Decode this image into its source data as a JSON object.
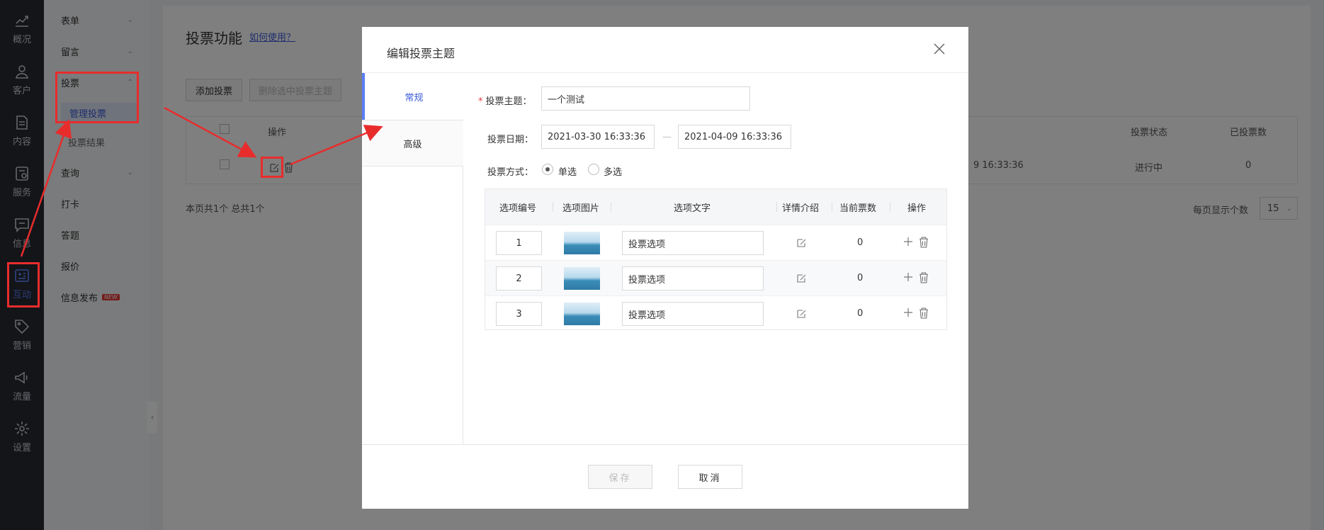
{
  "rail": {
    "items": [
      {
        "label": "概况",
        "icon": "chart-icon"
      },
      {
        "label": "客户",
        "icon": "user-icon"
      },
      {
        "label": "内容",
        "icon": "document-icon"
      },
      {
        "label": "服务",
        "icon": "service-icon"
      },
      {
        "label": "信息",
        "icon": "message-icon"
      },
      {
        "label": "互动",
        "icon": "interact-icon",
        "active": true
      },
      {
        "label": "营销",
        "icon": "tag-icon"
      },
      {
        "label": "流量",
        "icon": "megaphone-icon"
      },
      {
        "label": "设置",
        "icon": "settings-icon"
      }
    ]
  },
  "sidebar": {
    "items": [
      {
        "label": "表单"
      },
      {
        "label": "留言"
      },
      {
        "label": "投票"
      },
      {
        "label": "管理投票"
      },
      {
        "label": "投票结果"
      },
      {
        "label": "查询"
      },
      {
        "label": "打卡"
      },
      {
        "label": "答题"
      },
      {
        "label": "报价"
      },
      {
        "label": "信息发布",
        "badge": "NEW"
      }
    ]
  },
  "main": {
    "title": "投票功能",
    "help_link": "如何使用？",
    "add_button": "添加投票",
    "delete_button": "删除选中投票主题",
    "columns": {
      "action": "操作",
      "status": "投票状态",
      "votes": "已投票数"
    },
    "row": {
      "end_time": "9 16:33:36",
      "status": "进行中",
      "votes": "0"
    },
    "footer": "本页共1个  总共1个",
    "page_size_label": "每页显示个数",
    "page_size": "15"
  },
  "modal": {
    "title": "编辑投票主题",
    "tabs": [
      "常规",
      "高级"
    ],
    "topic_label": "投票主题：",
    "topic_value": "一个测试",
    "date_label": "投票日期：",
    "date_start": "2021-03-30 16:33:36",
    "date_end": "2021-04-09 16:33:36",
    "date_sep": "—",
    "mode_label": "投票方式：",
    "mode_single": "单选",
    "mode_multi": "多选",
    "table_headers": [
      "选项编号",
      "选项图片",
      "选项文字",
      "详情介绍",
      "当前票数",
      "操作"
    ],
    "options": [
      {
        "no": "1",
        "text": "投票选项",
        "votes": "0"
      },
      {
        "no": "2",
        "text": "投票选项",
        "votes": "0"
      },
      {
        "no": "3",
        "text": "投票选项",
        "votes": "0"
      }
    ],
    "save": "保存",
    "cancel": "取消"
  },
  "colors": {
    "accent": "#5b7df5",
    "annotation": "#e82c2c",
    "rail_bg": "#262a33"
  }
}
